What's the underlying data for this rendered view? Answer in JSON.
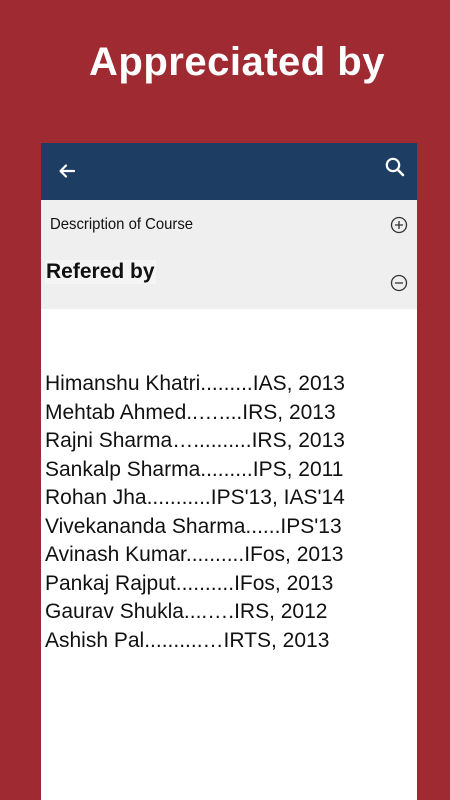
{
  "banner": {
    "title": "Appreciated by"
  },
  "appbar": {
    "background": "#1e3d63",
    "back_icon": "arrow-left-icon",
    "search_icon": "search-icon"
  },
  "accordion": {
    "description": {
      "label": "Description of Course",
      "icon": "plus-circle-icon",
      "expanded": false
    },
    "referred": {
      "label": "Refered by",
      "icon": "minus-circle-icon",
      "expanded": true
    }
  },
  "referrals": [
    "Himanshu Khatri.........IAS, 2013",
    "Mehtab Ahmed..…....IRS, 2013",
    "Rajni Sharma…..........IRS, 2013",
    "Sankalp Sharma.........IPS, 2011",
    "Rohan Jha...........IPS'13, IAS'14",
    "Vivekananda Sharma......IPS'13",
    "Avinash Kumar..........IFos, 2013",
    "Pankaj Rajput..........IFos, 2013",
    "Gaurav Shukla....….IRS, 2012",
    "Ashish Pal..........…IRTS, 2013"
  ],
  "colors": {
    "frame": "#9f2a31",
    "panel": "#efefef",
    "text": "#111111"
  }
}
